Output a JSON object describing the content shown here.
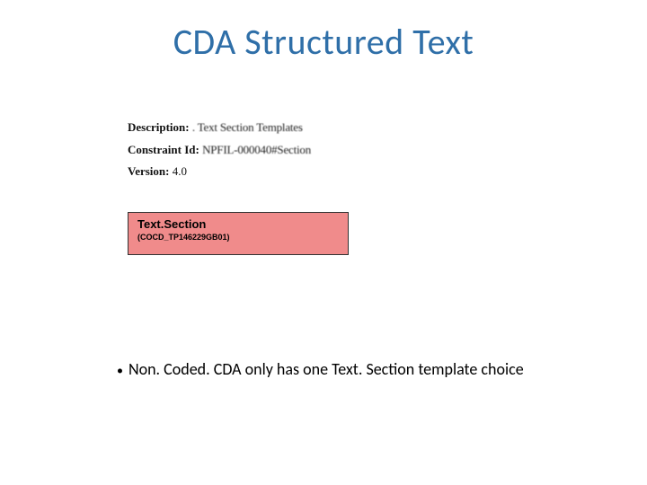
{
  "title": "CDA Structured Text",
  "meta": {
    "description_label": "Description:",
    "description_value": ". Text Section Templates",
    "constraint_label": "Constraint Id:",
    "constraint_value": "NPFIL-000040#Section",
    "version_label": "Version:",
    "version_value": "4.0"
  },
  "template_box": {
    "name": "Text.Section",
    "code": "(COCD_TP146229GB01)"
  },
  "bullet": {
    "dot": "•",
    "text": "Non. Coded. CDA only has one Text. Section template choice"
  }
}
